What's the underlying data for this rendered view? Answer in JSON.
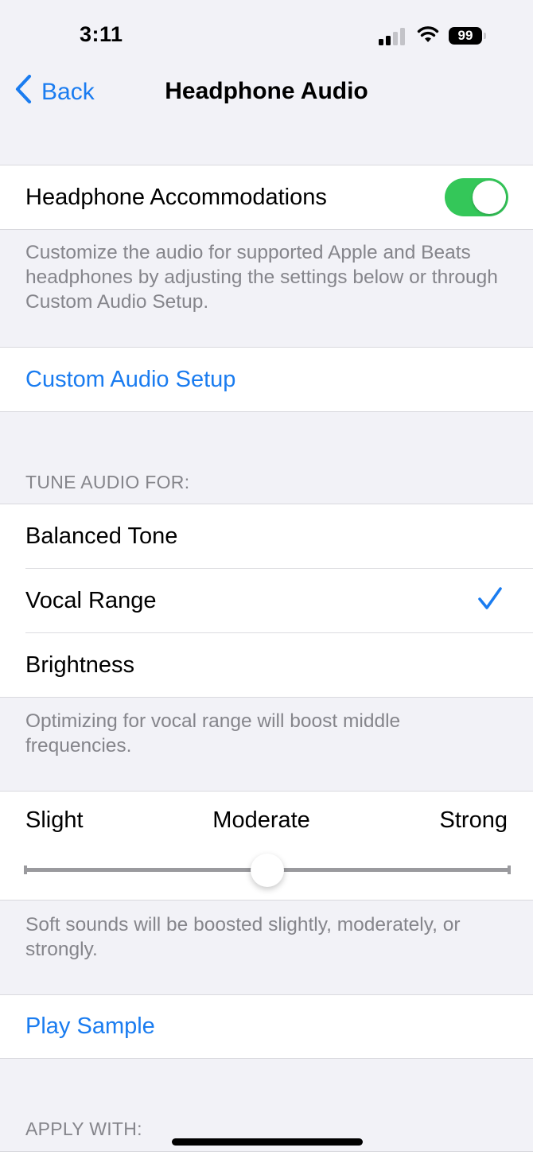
{
  "status_bar": {
    "time": "3:11",
    "signal_bars_active": 2,
    "signal_bars_total": 4,
    "wifi_icon": "wifi-icon",
    "battery_level": "99"
  },
  "nav": {
    "back_label": "Back",
    "back_icon": "chevron-left-icon",
    "title": "Headphone Audio"
  },
  "accommodations": {
    "label": "Headphone Accommodations",
    "enabled": true,
    "footer": "Customize the audio for supported Apple and Beats headphones by adjusting the settings below or through Custom Audio Setup."
  },
  "custom_audio_setup": {
    "label": "Custom Audio Setup"
  },
  "tune_audio": {
    "header": "TUNE AUDIO FOR:",
    "options": [
      {
        "label": "Balanced Tone",
        "selected": false
      },
      {
        "label": "Vocal Range",
        "selected": true
      },
      {
        "label": "Brightness",
        "selected": false
      }
    ],
    "footer": "Optimizing for vocal range will boost middle frequencies."
  },
  "boost": {
    "labels": [
      "Slight",
      "Moderate",
      "Strong"
    ],
    "value_fraction": 0.5,
    "selected": "Moderate",
    "footer": "Soft sounds will be boosted slightly, moderately, or strongly."
  },
  "play_sample": {
    "label": "Play Sample"
  },
  "apply_with": {
    "header": "APPLY WITH:"
  },
  "colors": {
    "accent": "#1a7cf0",
    "toggle_on": "#34c759",
    "background": "#f2f2f7",
    "secondary_text": "#85858b"
  }
}
